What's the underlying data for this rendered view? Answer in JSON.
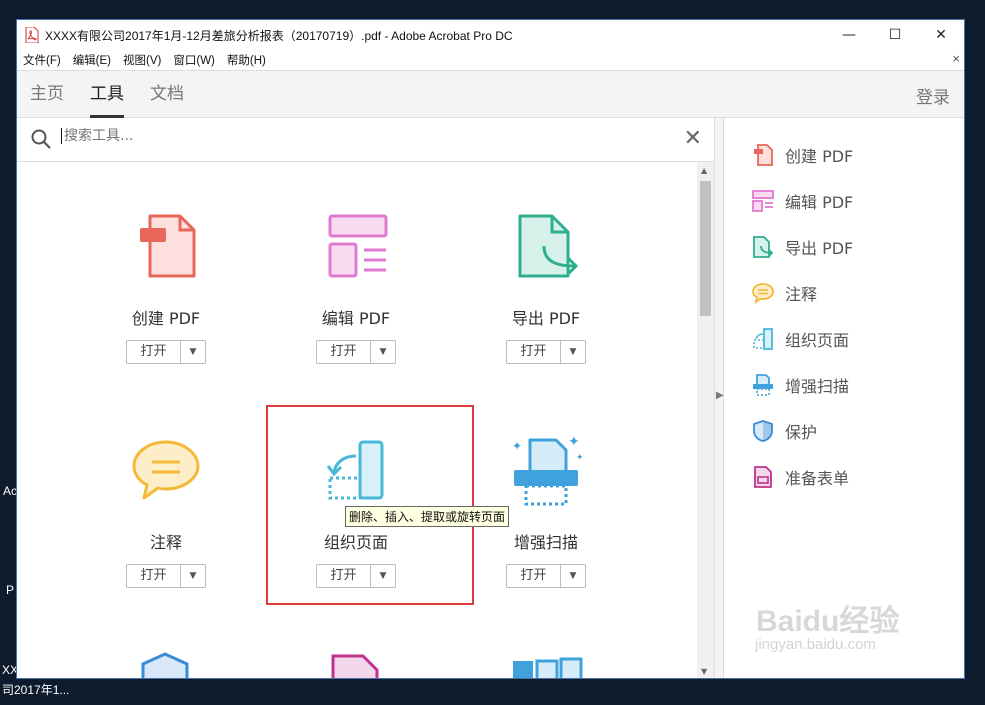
{
  "desktop": {
    "labels": [
      "Ac",
      "P",
      "XX",
      "司2017年1..."
    ]
  },
  "window": {
    "title": "XXXX有限公司2017年1月-12月差旅分析报表（20170719）.pdf - Adobe Acrobat Pro DC",
    "buttons": {
      "minimize": "—",
      "maximize": "☐",
      "close": "✕"
    }
  },
  "menu": {
    "items": [
      "文件(F)",
      "编辑(E)",
      "视图(V)",
      "窗口(W)",
      "帮助(H)"
    ],
    "close": "×"
  },
  "tabs": [
    {
      "label": "主页"
    },
    {
      "label": "工具"
    },
    {
      "label": "文档"
    }
  ],
  "login": "登录",
  "search": {
    "placeholder": "搜索工具...",
    "clear": "✕"
  },
  "tools": [
    {
      "name": "创建 PDF",
      "open": "打开",
      "icon": "create-pdf-icon"
    },
    {
      "name": "编辑 PDF",
      "open": "打开",
      "icon": "edit-pdf-icon"
    },
    {
      "name": "导出 PDF",
      "open": "打开",
      "icon": "export-pdf-icon"
    },
    {
      "name": "注释",
      "open": "打开",
      "icon": "comment-icon"
    },
    {
      "name": "组织页面",
      "open": "打开",
      "icon": "organize-pages-icon"
    },
    {
      "name": "增强扫描",
      "open": "打开",
      "icon": "enhance-scan-icon"
    }
  ],
  "tooltip": "删除、插入、提取或旋转页面",
  "right_panel": [
    {
      "label": "创建 PDF",
      "color": "#e8665a"
    },
    {
      "label": "编辑 PDF",
      "color": "#e07ad0"
    },
    {
      "label": "导出 PDF",
      "color": "#2fae8e"
    },
    {
      "label": "注释",
      "color": "#f5b93a"
    },
    {
      "label": "组织页面",
      "color": "#49b7d8"
    },
    {
      "label": "增强扫描",
      "color": "#3fa2dc"
    },
    {
      "label": "保护",
      "color": "#3a8bd6"
    },
    {
      "label": "准备表单",
      "color": "#c0338c"
    }
  ],
  "watermark": {
    "brand": "Baidu经验",
    "url": "jingyan.baidu.com"
  }
}
